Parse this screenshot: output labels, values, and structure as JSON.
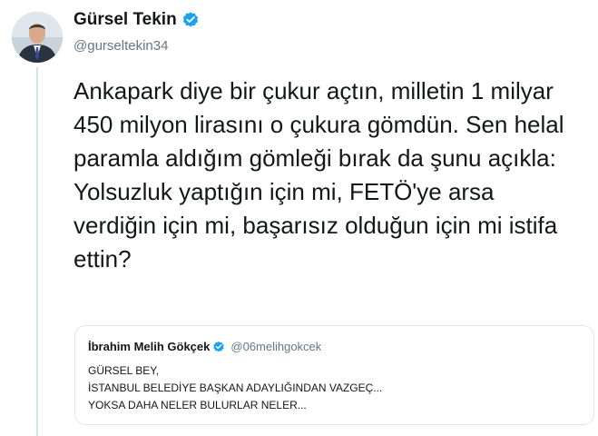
{
  "author": {
    "display_name": "Gürsel Tekin",
    "handle": "@gurseltekin34",
    "verified": true,
    "avatar_icon": "profile-photo"
  },
  "tweet": {
    "text": "Ankapark diye bir çukur açtın, milletin 1 milyar 450 milyon lirasını o çukura gömdün. Sen helal paramla aldığım gömleği bırak da şunu açıkla: Yolsuzluk yaptığın için mi, FETÖ'ye arsa verdiğin için mi, başarısız olduğun için mi istifa ettin?"
  },
  "quoted_tweet": {
    "display_name": "İbrahim Melih Gökçek",
    "handle": "@06melihgokcek",
    "verified": true,
    "lines": [
      "GÜRSEL BEY,",
      "İSTANBUL BELEDİYE BAŞKAN ADAYLIĞINDAN VAZGEÇ...",
      "YOKSA DAHA NELER BULURLAR NELER..."
    ]
  },
  "colors": {
    "verified_blue": "#1da1f2",
    "thread_line": "#cfe3f1",
    "secondary_text": "#657786",
    "border": "#e1e8ed"
  }
}
